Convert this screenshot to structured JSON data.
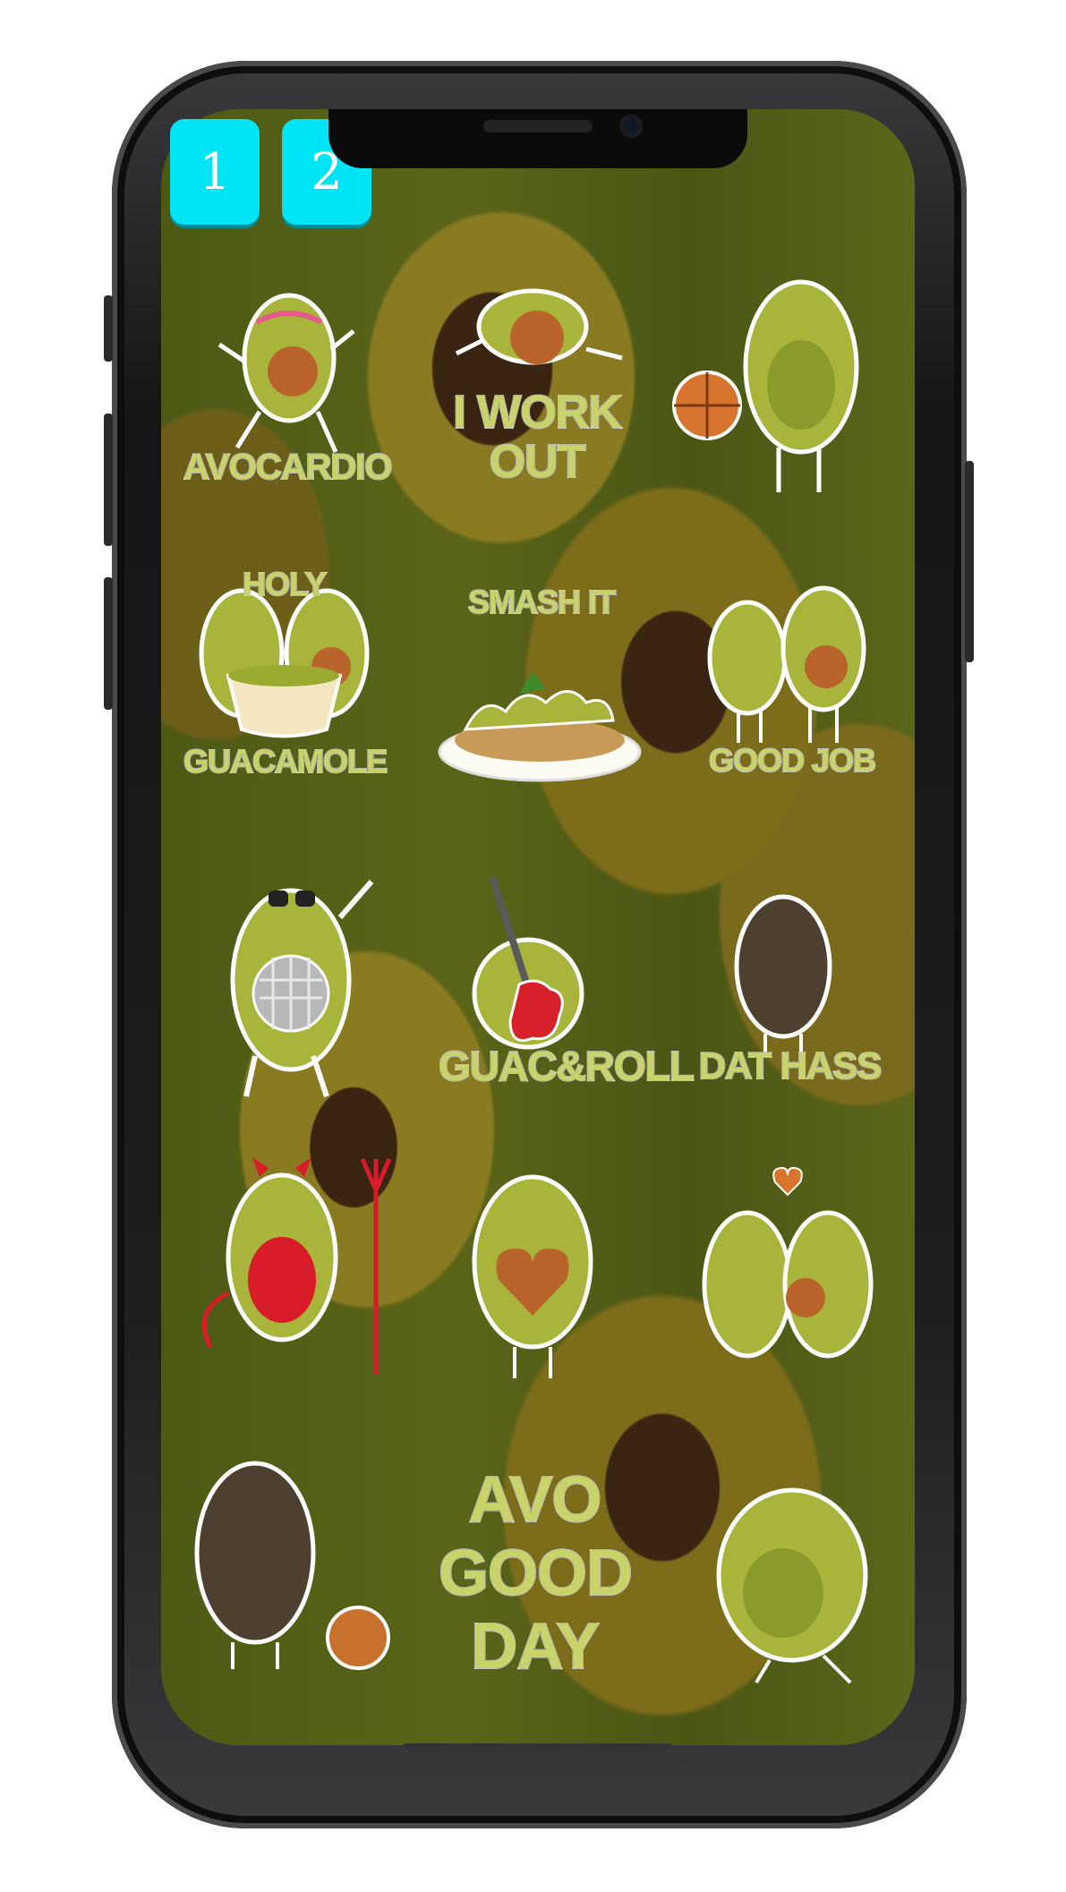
{
  "pager": {
    "page1": "1",
    "page2": "2"
  },
  "stickers": [
    {
      "name": "avocardio",
      "caption": "AVOCARDIO"
    },
    {
      "name": "i-work-out",
      "caption_line1": "I WORK",
      "caption_line2": "OUT"
    },
    {
      "name": "basketball-avocado"
    },
    {
      "name": "holy-guacamole",
      "caption_top": "HOLY",
      "caption": "GUACAMOLE"
    },
    {
      "name": "smash-it",
      "caption": "SMASH IT"
    },
    {
      "name": "good-job",
      "caption": "GOOD JOB"
    },
    {
      "name": "disco-avocado"
    },
    {
      "name": "guac-and-roll",
      "caption": "GUAC&ROLL"
    },
    {
      "name": "dat-hass",
      "caption": "DAT HASS"
    },
    {
      "name": "devil-avocado"
    },
    {
      "name": "heart-avocado"
    },
    {
      "name": "avocado-couple"
    },
    {
      "name": "dark-avocado-with-pit"
    },
    {
      "name": "avo-good-day",
      "caption_line1": "AVO",
      "caption_line2": "GOOD",
      "caption_line3": "DAY"
    },
    {
      "name": "shy-avocado"
    }
  ],
  "colors": {
    "button_bg": "#00e5f5",
    "caption_fill": "#c8d46a",
    "avocado_flesh": "#a8b43a",
    "avocado_pit": "#b8642a"
  }
}
